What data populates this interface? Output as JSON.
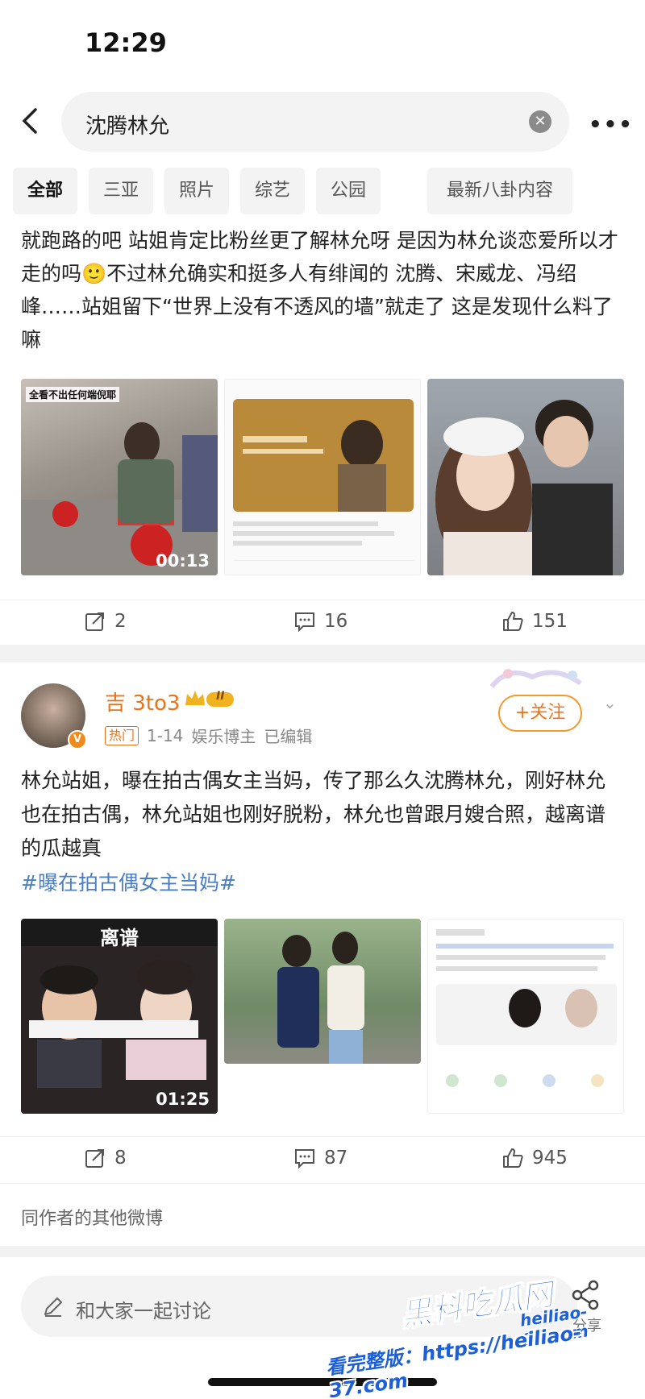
{
  "status_bar": {
    "time": "12:29"
  },
  "search": {
    "query": "沈腾林允"
  },
  "filters": [
    {
      "label": "全部"
    },
    {
      "label": "三亚"
    },
    {
      "label": "照片"
    },
    {
      "label": "综艺"
    },
    {
      "label": "公园"
    },
    {
      "label": "最新八卦内容"
    }
  ],
  "post1": {
    "text": "就跑路的吧 站姐肯定比粉丝更了解林允呀 是因为林允谈恋爱所以才走的吗🙂不过林允确实和挺多人有绯闻的 沈腾、宋威龙、冯绍峰……站姐留下“世界上没有不透风的墙”就走了 这是发现什么料了嘛",
    "images": [
      {
        "caption": "全看不出任何端倪耶",
        "duration": "00:13"
      },
      {
        "caption": ""
      },
      {
        "caption": ""
      }
    ],
    "actions": {
      "reposts": "2",
      "comments": "16",
      "likes": "151"
    }
  },
  "post2": {
    "username": "吉 3to3",
    "level_badge": "II",
    "hot_tag": "热门",
    "date": "1-14",
    "author_type": "娱乐博主",
    "edited": "已编辑",
    "follow_label": "+关注",
    "text": "林允站姐，曝在拍古偶女主当妈，传了那么久沈腾林允，刚好林允也在拍古偶，林允站姐也刚好脱粉，林允也曾跟月嫂合照，越离谱的瓜越真",
    "hashtag": "#曝在拍古偶女主当妈#",
    "images": [
      {
        "caption": "离谱",
        "duration": "01:25"
      },
      {
        "caption": ""
      },
      {
        "caption": ""
      }
    ],
    "actions": {
      "reposts": "8",
      "comments": "87",
      "likes": "945"
    }
  },
  "other_posts_label": "同作者的其他微博",
  "bottom": {
    "comment_placeholder": "和大家一起讨论",
    "share_label": "分享"
  },
  "watermark": {
    "logo": "黑料吃瓜网",
    "url_short": "heiliao-37.com",
    "url_full": "看完整版：https://heiliao-37.com"
  },
  "colors": {
    "accent_orange": "#f0761a",
    "link_blue": "#4b7fc4"
  }
}
